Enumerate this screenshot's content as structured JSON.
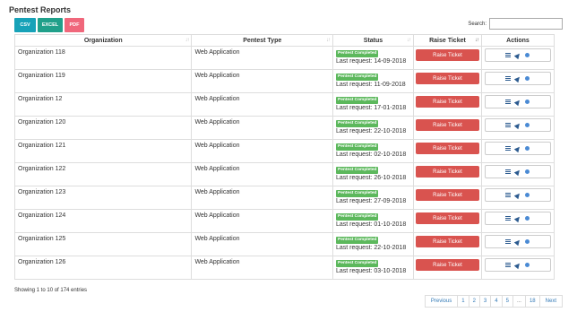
{
  "page": {
    "title": "Pentest Reports"
  },
  "export": {
    "csv": "CSV",
    "excel": "EXCEL",
    "pdf": "PDF"
  },
  "search": {
    "label": "Search:",
    "value": ""
  },
  "table": {
    "headers": {
      "organization": "Organization",
      "type": "Pentest Type",
      "status": "Status",
      "ticket": "Raise Ticket",
      "actions": "Actions"
    },
    "rows": [
      {
        "organization": "Organization 118",
        "type": "Web Application",
        "status": "Pentest Completed",
        "last_request": "Last request: 14-09-2018",
        "ticket": "Raise Ticket"
      },
      {
        "organization": "Organization 119",
        "type": "Web Application",
        "status": "Pentest Completed",
        "last_request": "Last request: 11-09-2018",
        "ticket": "Raise Ticket"
      },
      {
        "organization": "Organization 12",
        "type": "Web Application",
        "status": "Pentest Completed",
        "last_request": "Last request: 17-01-2018",
        "ticket": "Raise Ticket"
      },
      {
        "organization": "Organization 120",
        "type": "Web Application",
        "status": "Pentest Completed",
        "last_request": "Last request: 22-10-2018",
        "ticket": "Raise Ticket"
      },
      {
        "organization": "Organization 121",
        "type": "Web Application",
        "status": "Pentest Completed",
        "last_request": "Last request: 02-10-2018",
        "ticket": "Raise Ticket"
      },
      {
        "organization": "Organization 122",
        "type": "Web Application",
        "status": "Pentest Completed",
        "last_request": "Last request: 26-10-2018",
        "ticket": "Raise Ticket"
      },
      {
        "organization": "Organization 123",
        "type": "Web Application",
        "status": "Pentest Completed",
        "last_request": "Last request: 27-09-2018",
        "ticket": "Raise Ticket"
      },
      {
        "organization": "Organization 124",
        "type": "Web Application",
        "status": "Pentest Completed",
        "last_request": "Last request: 01-10-2018",
        "ticket": "Raise Ticket"
      },
      {
        "organization": "Organization 125",
        "type": "Web Application",
        "status": "Pentest Completed",
        "last_request": "Last request: 22-10-2018",
        "ticket": "Raise Ticket"
      },
      {
        "organization": "Organization 126",
        "type": "Web Application",
        "status": "Pentest Completed",
        "last_request": "Last request: 03-10-2018",
        "ticket": "Raise Ticket"
      }
    ],
    "action_icons": [
      "list-icon",
      "send-icon",
      "circle-icon"
    ]
  },
  "info": "Showing 1 to 10 of 174 entries",
  "pagination": {
    "previous": "Previous",
    "pages": [
      "1",
      "2",
      "3",
      "4",
      "5",
      "...",
      "18"
    ],
    "next": "Next"
  },
  "colors": {
    "csv": "#17a2b8",
    "excel": "#20a08a",
    "pdf": "#f0677b",
    "status_badge": "#5cb85c",
    "raise_ticket": "#d9534f",
    "icon": "#2b5a8f"
  }
}
